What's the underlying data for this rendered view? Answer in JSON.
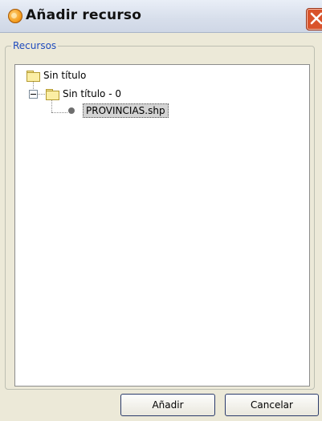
{
  "window": {
    "title": "Añadir recurso",
    "app_icon": "gvsig-logo-icon",
    "close_icon": "close-icon"
  },
  "group": {
    "legend": "Recursos"
  },
  "tree": {
    "root": {
      "label": "Sin título",
      "icon": "folder-icon"
    },
    "child": {
      "label": "Sin título - 0",
      "icon": "folder-icon",
      "expander": "collapse-icon",
      "expanded": true
    },
    "leaf": {
      "label": "PROVINCIAS.shp",
      "icon": "layer-dot-icon",
      "selected": true
    }
  },
  "buttons": {
    "add": "Añadir",
    "cancel": "Cancelar"
  },
  "colors": {
    "background": "#ece9d8",
    "legend": "#1f4bbd",
    "close_button": "#d9532b",
    "selection": "#d3d3d3"
  }
}
